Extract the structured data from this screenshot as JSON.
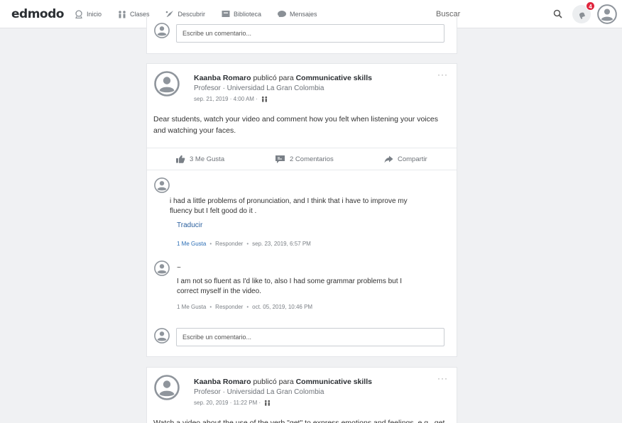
{
  "app": {
    "logo": "edmodo"
  },
  "nav": [
    {
      "label": "Inicio",
      "icon": "home-icon"
    },
    {
      "label": "Clases",
      "icon": "classes-icon"
    },
    {
      "label": "Descubrir",
      "icon": "discover-icon"
    },
    {
      "label": "Biblioteca",
      "icon": "library-icon"
    },
    {
      "label": "Mensajes",
      "icon": "messages-icon"
    }
  ],
  "search": {
    "placeholder": "Buscar"
  },
  "notifications": {
    "count": "4"
  },
  "top_card": {
    "comment_placeholder": "Escribe un comentario..."
  },
  "posts": [
    {
      "author": "Kaanba Romaro",
      "published_for": "publicó para",
      "group": "Communicative skills",
      "role": "Profesor · Universidad La Gran Colombia",
      "date": "sep. 21, 2019 · 4:00 AM ·",
      "body": "Dear students, watch your video and comment how you felt when listening your voices and watching your faces.",
      "likes": "3 Me Gusta",
      "comments": "2 Comentarios",
      "share": "Compartir",
      "comment_list": [
        {
          "text": "i had a little problems of pronunciation, and I think that i have to improve my fluency but I felt good do it .",
          "translate": "Traducir",
          "likes": "1 Me Gusta",
          "reply": "Responder",
          "date": "sep. 23, 2019, 6:57 PM"
        },
        {
          "mark": "~",
          "text": "I am not so fluent as I'd like to, also I had some grammar problems but I correct myself in the video.",
          "likes": "1 Me Gusta",
          "reply": "Responder",
          "date": "oct. 05, 2019, 10:46 PM"
        }
      ],
      "comment_placeholder": "Escribe un comentario..."
    },
    {
      "author": "Kaanba Romaro",
      "published_for": "publicó para",
      "group": "Communicative skills",
      "role": "Profesor · Universidad La Gran Colombia",
      "date": "sep. 20, 2019 · 11:22 PM ·",
      "body": "Watch a video about the use of the verb \"get\" to express emotions and feelings, e.g., get"
    }
  ],
  "colors": {
    "accent": "#2a6db5",
    "badge": "#e0263e",
    "background": "#f0f1f3"
  }
}
